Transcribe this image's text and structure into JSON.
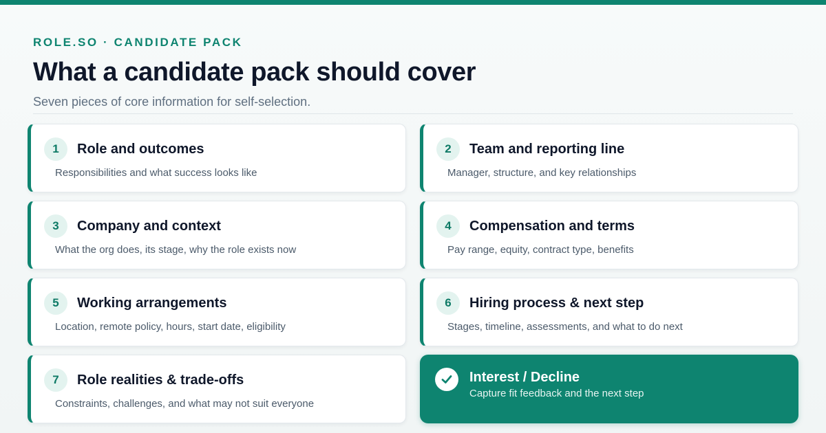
{
  "header": {
    "eyebrow": "ROLE.SO · CANDIDATE PACK",
    "title": "What a candidate pack should cover",
    "subtitle": "Seven pieces of core information for self-selection."
  },
  "items": [
    {
      "number": "1",
      "title": "Role and outcomes",
      "description": "Responsibilities and what success looks like"
    },
    {
      "number": "2",
      "title": "Team and reporting line",
      "description": "Manager, structure, and key relationships"
    },
    {
      "number": "3",
      "title": "Company and context",
      "description": "What the org does, its stage, why the role exists now"
    },
    {
      "number": "4",
      "title": "Compensation and terms",
      "description": "Pay range, equity, contract type, benefits"
    },
    {
      "number": "5",
      "title": "Working arrangements",
      "description": "Location, remote policy, hours, start date, eligibility"
    },
    {
      "number": "6",
      "title": "Hiring process & next step",
      "description": "Stages, timeline, assessments, and what to do next"
    },
    {
      "number": "7",
      "title": "Role realities & trade-offs",
      "description": "Constraints, challenges, and what may not suit everyone"
    }
  ],
  "cta": {
    "icon": "check-icon",
    "title": "Interest / Decline",
    "description": "Capture fit feedback and the next step"
  },
  "colors": {
    "accent": "#0e8470",
    "title_text": "#0f172a",
    "muted_text": "#5f6f80"
  }
}
